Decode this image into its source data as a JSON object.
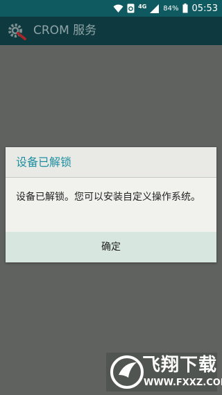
{
  "status_bar": {
    "network": "4G",
    "battery_percent": "84%",
    "time": "05:53",
    "icons": [
      "wifi-icon",
      "sync-icon",
      "signal-icon",
      "battery-icon"
    ]
  },
  "app_bar": {
    "title": "CROM 服务",
    "logo_icon": "gear-wrench-icon"
  },
  "dialog": {
    "title": "设备已解锁",
    "message": "设备已解锁。您可以安装自定义操作系统。",
    "confirm_label": "确定"
  },
  "watermark": {
    "brand": "飞翔下载",
    "url": "WWW.FXXZ.COM"
  },
  "colors": {
    "status_bar": "#0f5a60",
    "app_bar": "#0e3a3f",
    "background": "#5f625e",
    "dialog_title_text": "#1e8fa0",
    "dialog_button": "#d7e6df"
  }
}
